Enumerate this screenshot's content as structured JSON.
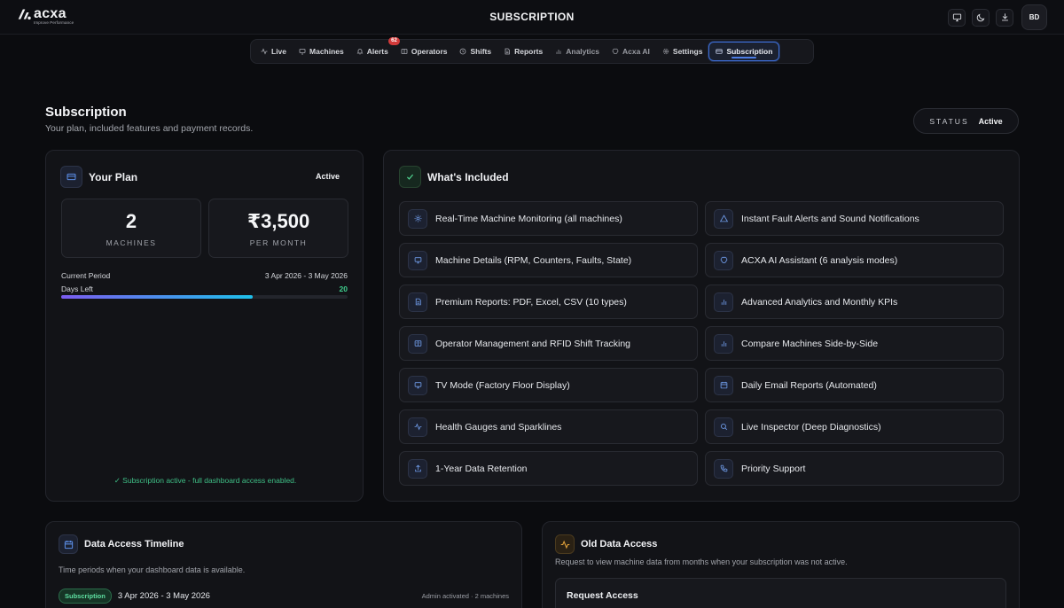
{
  "header": {
    "logo_name": "acxa",
    "logo_tagline": "Improve Performance",
    "title": "SUBSCRIPTION",
    "avatar_initials": "BD"
  },
  "nav": {
    "items": [
      {
        "label": "Live",
        "icon": "activity-icon"
      },
      {
        "label": "Machines",
        "icon": "monitor-icon"
      },
      {
        "label": "Alerts",
        "icon": "bell-icon",
        "badge": "62"
      },
      {
        "label": "Operators",
        "icon": "id-card-icon"
      },
      {
        "label": "Shifts",
        "icon": "clock-icon"
      },
      {
        "label": "Reports",
        "icon": "file-icon"
      },
      {
        "label": "Analytics",
        "icon": "bar-chart-icon"
      },
      {
        "label": "Acxa AI",
        "icon": "brain-icon"
      },
      {
        "label": "Settings",
        "icon": "gear-icon"
      },
      {
        "label": "Subscription",
        "icon": "card-icon",
        "active": true
      }
    ]
  },
  "page": {
    "title": "Subscription",
    "subtitle": "Your plan, included features and payment records.",
    "status_label": "STATUS",
    "status_value": "Active"
  },
  "plan": {
    "title": "Your Plan",
    "state": "Active",
    "machines_value": "2",
    "machines_label": "MACHINES",
    "price_value": "₹3,500",
    "price_label": "PER MONTH",
    "period_label": "Current Period",
    "period_value": "3 Apr 2026 - 3 May 2026",
    "days_left_label": "Days Left",
    "days_left_value": "20",
    "progress_fraction": 0.67,
    "footer": "✓ Subscription active - full dashboard access enabled."
  },
  "included": {
    "title": "What's Included",
    "features": [
      {
        "label": "Real-Time Machine Monitoring (all machines)",
        "icon": "sun-icon"
      },
      {
        "label": "Instant Fault Alerts and Sound Notifications",
        "icon": "warning-icon"
      },
      {
        "label": "Machine Details (RPM, Counters, Faults, State)",
        "icon": "monitor-icon"
      },
      {
        "label": "ACXA AI Assistant (6 analysis modes)",
        "icon": "brain-icon"
      },
      {
        "label": "Premium Reports: PDF, Excel, CSV (10 types)",
        "icon": "file-icon"
      },
      {
        "label": "Advanced Analytics and Monthly KPIs",
        "icon": "bar-chart-icon"
      },
      {
        "label": "Operator Management and RFID Shift Tracking",
        "icon": "id-card-icon"
      },
      {
        "label": "Compare Machines Side-by-Side",
        "icon": "bar-chart-icon"
      },
      {
        "label": "TV Mode (Factory Floor Display)",
        "icon": "monitor-icon"
      },
      {
        "label": "Daily Email Reports (Automated)",
        "icon": "calendar-icon"
      },
      {
        "label": "Health Gauges and Sparklines",
        "icon": "activity-icon"
      },
      {
        "label": "Live Inspector (Deep Diagnostics)",
        "icon": "search-icon"
      },
      {
        "label": "1-Year Data Retention",
        "icon": "upload-icon"
      },
      {
        "label": "Priority Support",
        "icon": "phone-icon"
      }
    ]
  },
  "timeline": {
    "title": "Data Access Timeline",
    "subtitle": "Time periods when your dashboard data is available.",
    "tag": "Subscription",
    "range": "3 Apr 2026 - 3 May 2026",
    "meta": "Admin activated · 2 machines"
  },
  "old_data": {
    "title": "Old Data Access",
    "subtitle": "Request to view machine data from months when your subscription was not active.",
    "request_title": "Request Access"
  },
  "colors": {
    "accent": "#3e6fd8",
    "success": "#3fcf8e",
    "badge": "#d23a3a"
  }
}
